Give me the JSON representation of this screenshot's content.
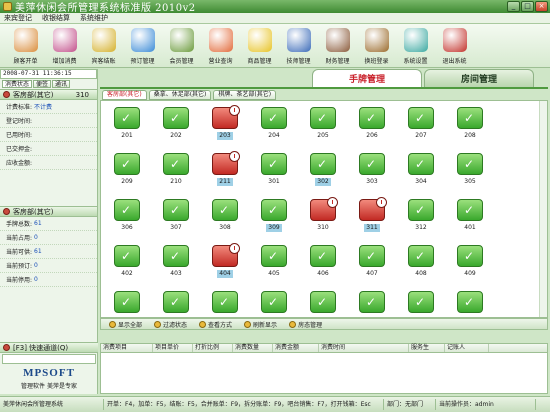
{
  "window": {
    "title": "美萍休闲会所管理系统标准版 2010v2"
  },
  "menu": [
    "来宾登记",
    "收银结算",
    "系统维护"
  ],
  "toolbar": [
    {
      "label": "顾客开单",
      "icon": "customer-icon",
      "color": "#d98c3a"
    },
    {
      "label": "增加消费",
      "icon": "add-consumption-icon",
      "color": "#c24f8a"
    },
    {
      "label": "宾客结账",
      "icon": "checkout-icon",
      "color": "#d4b02a"
    },
    {
      "label": "预订管理",
      "icon": "clock-icon",
      "color": "#3a8ad6"
    },
    {
      "label": "会员管理",
      "icon": "members-icon",
      "color": "#6a9a3a"
    },
    {
      "label": "营业查询",
      "icon": "query-icon",
      "color": "#e26a3a"
    },
    {
      "label": "商品管理",
      "icon": "star-icon",
      "color": "#e7c324"
    },
    {
      "label": "技师管理",
      "icon": "technician-icon",
      "color": "#3a6ab8"
    },
    {
      "label": "财务管理",
      "icon": "finance-icon",
      "color": "#8a5a3a"
    },
    {
      "label": "换班登录",
      "icon": "shift-icon",
      "color": "#9a6a2a"
    },
    {
      "label": "系统设置",
      "icon": "gear-icon",
      "color": "#3aa8a0"
    },
    {
      "label": "退出系统",
      "icon": "exit-icon",
      "color": "#c2312a"
    }
  ],
  "left": {
    "clock": "2008-07-31 11:36:15",
    "tabs": [
      "消费状态",
      "便签",
      "通讯"
    ],
    "room_section": {
      "title": "客房部(其它)",
      "count": "310"
    },
    "room_fields": [
      {
        "label": "计费标准:",
        "value": "不计费"
      },
      {
        "label": "登记时间:",
        "value": ""
      },
      {
        "label": "已用时间:",
        "value": ""
      },
      {
        "label": "已交押金:",
        "value": ""
      },
      {
        "label": "应收金额:",
        "value": ""
      }
    ],
    "stats_section": {
      "title": "客房部(其它)"
    },
    "stats_fields": [
      {
        "label": "手牌总数:",
        "value": "61"
      },
      {
        "label": "当前占用:",
        "value": "0"
      },
      {
        "label": "当前可供:",
        "value": "61"
      },
      {
        "label": "当前预订:",
        "value": "0"
      },
      {
        "label": "当前停用:",
        "value": "0"
      }
    ],
    "quick_channel": "[F3] 快速通道(Q)",
    "brand": "MPSOFT",
    "slogan": "管理软件 美萍是专家"
  },
  "main_tabs": [
    "手牌管理",
    "房间管理"
  ],
  "sub_tabs": [
    "客房部(其它)",
    "桑拿、休足部(其它)",
    "棋牌、茶艺部(其它)"
  ],
  "rooms": [
    {
      "num": "201",
      "status": "free",
      "hi": false
    },
    {
      "num": "202",
      "status": "free",
      "hi": false
    },
    {
      "num": "203",
      "status": "busy",
      "hi": true
    },
    {
      "num": "204",
      "status": "free",
      "hi": false
    },
    {
      "num": "205",
      "status": "free",
      "hi": false
    },
    {
      "num": "206",
      "status": "free",
      "hi": false
    },
    {
      "num": "207",
      "status": "free",
      "hi": false
    },
    {
      "num": "208",
      "status": "free",
      "hi": false
    },
    {
      "num": "209",
      "status": "free",
      "hi": false
    },
    {
      "num": "210",
      "status": "free",
      "hi": false
    },
    {
      "num": "211",
      "status": "busy",
      "hi": true
    },
    {
      "num": "301",
      "status": "free",
      "hi": false
    },
    {
      "num": "302",
      "status": "free",
      "hi": true
    },
    {
      "num": "303",
      "status": "free",
      "hi": false
    },
    {
      "num": "304",
      "status": "free",
      "hi": false
    },
    {
      "num": "305",
      "status": "free",
      "hi": false
    },
    {
      "num": "306",
      "status": "free",
      "hi": false
    },
    {
      "num": "307",
      "status": "free",
      "hi": false
    },
    {
      "num": "308",
      "status": "free",
      "hi": false
    },
    {
      "num": "309",
      "status": "free",
      "hi": true
    },
    {
      "num": "310",
      "status": "busy",
      "hi": false
    },
    {
      "num": "311",
      "status": "busy",
      "hi": true
    },
    {
      "num": "312",
      "status": "free",
      "hi": false
    },
    {
      "num": "401",
      "status": "free",
      "hi": false
    },
    {
      "num": "402",
      "status": "free",
      "hi": false
    },
    {
      "num": "403",
      "status": "free",
      "hi": false
    },
    {
      "num": "404",
      "status": "busy",
      "hi": true
    },
    {
      "num": "405",
      "status": "free",
      "hi": false
    },
    {
      "num": "406",
      "status": "free",
      "hi": false
    },
    {
      "num": "407",
      "status": "free",
      "hi": false
    },
    {
      "num": "408",
      "status": "free",
      "hi": false
    },
    {
      "num": "409",
      "status": "free",
      "hi": false
    },
    {
      "num": "",
      "status": "free",
      "hi": false
    },
    {
      "num": "",
      "status": "free",
      "hi": false
    },
    {
      "num": "",
      "status": "free",
      "hi": false
    },
    {
      "num": "",
      "status": "free",
      "hi": false
    },
    {
      "num": "",
      "status": "free",
      "hi": false
    },
    {
      "num": "",
      "status": "free",
      "hi": false
    },
    {
      "num": "",
      "status": "free",
      "hi": false
    },
    {
      "num": "",
      "status": "free",
      "hi": false
    }
  ],
  "actions": [
    "显示全部",
    "过滤状态",
    "查看方式",
    "刷新显示",
    "房态管理"
  ],
  "table_headers": [
    "消费项目",
    "项目单价",
    "打折比例",
    "消费数量",
    "消费金额",
    "消费时间",
    "服务生",
    "记账人"
  ],
  "status_bar": [
    "美萍休闲会所管理系统",
    "开单：F4，加单：F5，结账：F5，合并账单：F9，拆分账单：F9，吧台销售：F7，打开钱箱：Esc",
    "部门：无部门",
    "当前操作员：admin"
  ]
}
